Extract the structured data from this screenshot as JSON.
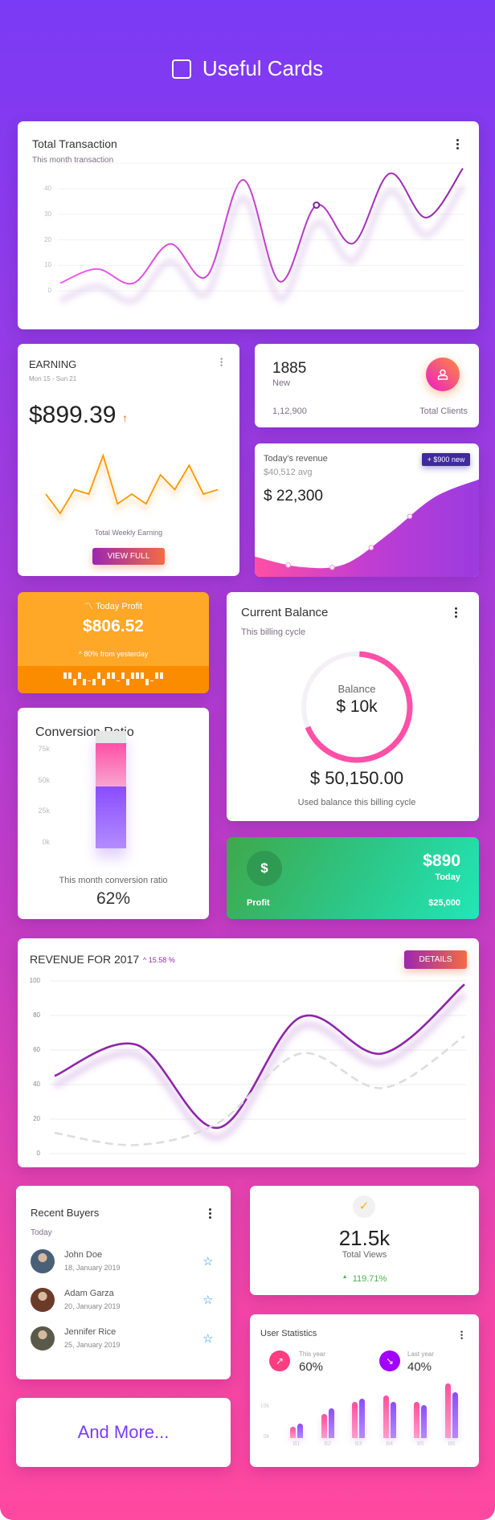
{
  "header": {
    "title": "Useful Cards",
    "icon": "square-outline-icon"
  },
  "total_transaction": {
    "title": "Total Transaction",
    "subtitle": "This month transaction"
  },
  "earning": {
    "title": "EARNING",
    "date_range": "Mon 15 - Sun 21",
    "amount": "$899.39",
    "trend_icon": "arrow-up-icon",
    "caption": "Total Weekly Earning",
    "button": "VIEW FULL"
  },
  "clients": {
    "new_count": "1885",
    "new_label": "New",
    "total": "1,12,900",
    "total_label": "Total Clients",
    "icon": "user-icon"
  },
  "today_revenue": {
    "title": "Today's revenue",
    "avg": "$40,512 avg",
    "amount": "$ 22,300",
    "badge": "+ $900 new"
  },
  "today_profit": {
    "title": "Today Profit",
    "amount": "$806.52",
    "change": "80% from yesterday",
    "ticker": [
      1,
      1,
      0,
      1,
      0,
      -1,
      0,
      1,
      0,
      1,
      1,
      -1,
      1,
      0,
      1,
      1,
      1,
      0,
      -1,
      1,
      1
    ],
    "colors": {
      "bg": "#ffa726",
      "strip": "#fb8c00"
    }
  },
  "conversion": {
    "title": "Conversion Ratio",
    "caption": "This month conversion ratio",
    "value": "62%"
  },
  "balance": {
    "title": "Current Balance",
    "subtitle": "This billing cycle",
    "center_label": "Balance",
    "center_value": "$ 10k",
    "amount": "$ 50,150.00",
    "caption": "Used balance this billing cycle",
    "used_percent": 68,
    "color": "#ff4fa6"
  },
  "profit_card": {
    "amount": "$890",
    "period": "Today",
    "label": "Profit",
    "total": "$25,000",
    "icon": "dollar-icon"
  },
  "revenue_2017": {
    "title": "REVENUE FOR 2017",
    "change": "15.58 %",
    "button": "DETAILS"
  },
  "recent_buyers": {
    "title": "Recent Buyers",
    "subtitle": "Today",
    "buyers": [
      {
        "name": "John Doe",
        "date": "18, January 2019"
      },
      {
        "name": "Adam Garza",
        "date": "20, January 2019"
      },
      {
        "name": "Jennifer Rice",
        "date": "25, January 2019"
      }
    ]
  },
  "and_more": {
    "label": "And More..."
  },
  "views": {
    "value": "21.5k",
    "label": "Total Views",
    "change": "119.71%",
    "icon": "check-icon"
  },
  "user_stats": {
    "title": "User Statistics",
    "this_year_label": "This year",
    "this_year_value": "60%",
    "last_year_label": "Last year",
    "last_year_value": "40%"
  },
  "chart_data": [
    {
      "id": "total_transaction",
      "type": "line",
      "yticks": [
        "0",
        "10",
        "20",
        "30",
        "40"
      ],
      "ylim": [
        0,
        50
      ],
      "grid": true,
      "values": [
        3,
        8.6,
        3,
        18.4,
        5.7,
        43.5,
        3.6,
        33.6,
        18.6,
        46,
        28.7,
        48
      ],
      "colors": [
        "#f55cf0",
        "#8e24aa"
      ]
    },
    {
      "id": "earning",
      "type": "line",
      "values": [
        115,
        50,
        130,
        115,
        245,
        82,
        115,
        82,
        180,
        130,
        212,
        115,
        130
      ],
      "color": "#ff9800"
    },
    {
      "id": "today_revenue",
      "type": "area",
      "values": [
        12,
        4,
        6,
        30,
        58,
        72
      ],
      "markers": [
        1,
        2,
        3,
        4
      ]
    },
    {
      "id": "conversion",
      "type": "bar",
      "yticks": [
        "75k",
        "50k",
        "25k",
        "0k"
      ],
      "ylim": [
        0,
        75
      ],
      "stack": [
        {
          "value": 50,
          "color": "#8a4dff"
        },
        {
          "value": 35,
          "color": "#ff4fa6"
        },
        {
          "value": 10,
          "color": "#e6e6e6"
        }
      ]
    },
    {
      "id": "revenue_2017",
      "type": "line",
      "yticks": [
        "100",
        "80",
        "60",
        "40",
        "20",
        "0"
      ],
      "ylim": [
        0,
        100
      ],
      "grid": true,
      "series": [
        {
          "values": [
            45,
            63,
            15,
            79,
            58,
            98
          ],
          "color": "#8e24aa",
          "style": "solid"
        },
        {
          "values": [
            12,
            5,
            18,
            58,
            38,
            68
          ],
          "color": "#dddddd",
          "style": "dashed"
        }
      ]
    },
    {
      "id": "user_stats",
      "type": "bar",
      "categories": [
        "B1",
        "B2",
        "B3",
        "B4",
        "B5",
        "B6"
      ],
      "yticks": [
        "10k",
        "0k"
      ],
      "series": [
        {
          "name": "This year",
          "values": [
            3.6,
            7.9,
            11.9,
            14,
            11.9,
            17.9
          ],
          "color": "#ff4f9a"
        },
        {
          "name": "Last year",
          "values": [
            4.7,
            9.8,
            13,
            11.9,
            10.9,
            15
          ],
          "color": "#8a4dff"
        }
      ]
    }
  ]
}
